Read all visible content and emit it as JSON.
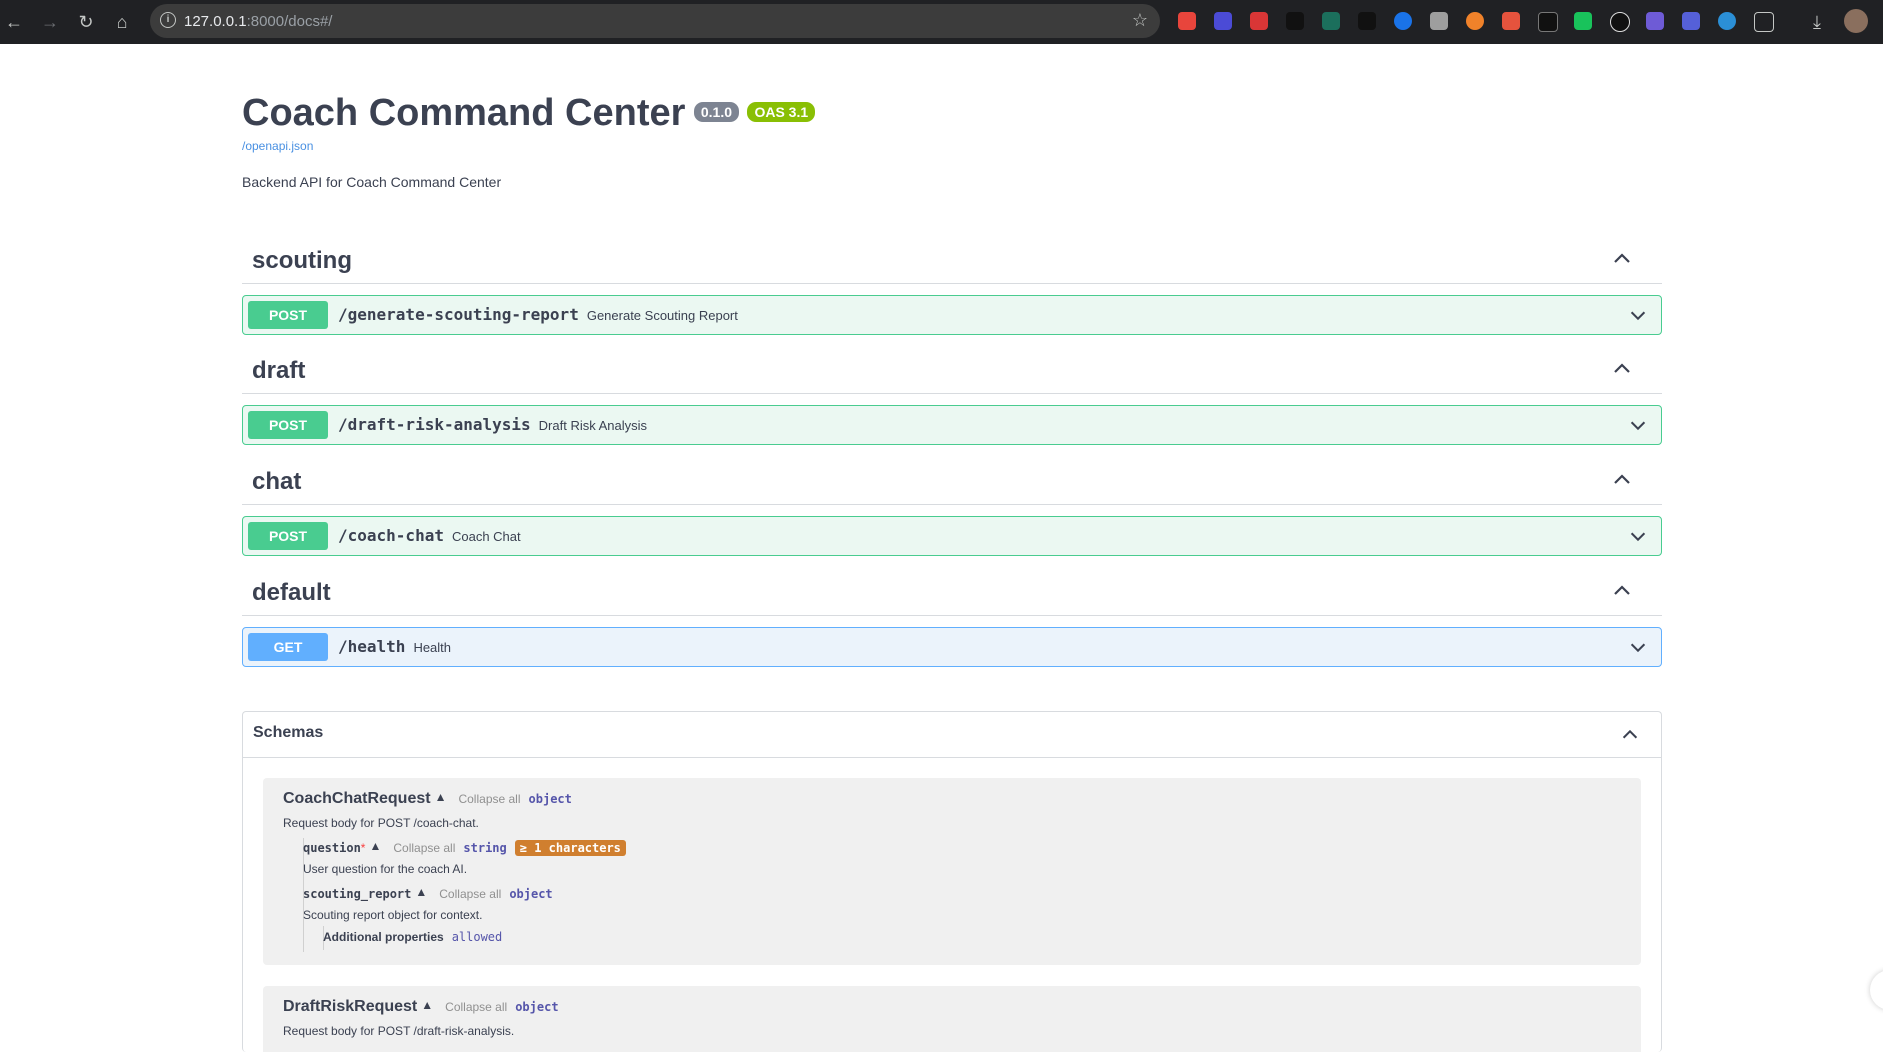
{
  "browser": {
    "url_host": "127.0.0.1",
    "url_rest": ":8000/docs#/"
  },
  "api": {
    "title": "Coach Command Center",
    "version": "0.1.0",
    "oas": "OAS 3.1",
    "spec_link": "/openapi.json",
    "description": "Backend API for Coach Command Center"
  },
  "tags": [
    {
      "name": "scouting",
      "op": {
        "method": "POST",
        "path": "/generate-scouting-report",
        "summary": "Generate Scouting Report"
      }
    },
    {
      "name": "draft",
      "op": {
        "method": "POST",
        "path": "/draft-risk-analysis",
        "summary": "Draft Risk Analysis"
      }
    },
    {
      "name": "chat",
      "op": {
        "method": "POST",
        "path": "/coach-chat",
        "summary": "Coach Chat"
      }
    },
    {
      "name": "default",
      "op": {
        "method": "GET",
        "path": "/health",
        "summary": "Health"
      }
    }
  ],
  "schemas": {
    "title": "Schemas",
    "models": [
      {
        "name": "CoachChatRequest",
        "collapse": "Collapse all",
        "type": "object",
        "description": "Request body for POST /coach-chat.",
        "props": [
          {
            "name": "question",
            "required": "*",
            "collapse": "Collapse all",
            "type": "string",
            "chip": "≥ 1 characters",
            "description": "User question for the coach AI."
          },
          {
            "name": "scouting_report",
            "collapse": "Collapse all",
            "type": "object",
            "description": "Scouting report object for context.",
            "additional_label": "Additional properties",
            "additional_value": "allowed"
          }
        ]
      },
      {
        "name": "DraftRiskRequest",
        "collapse": "Collapse all",
        "type": "object",
        "description": "Request body for POST /draft-risk-analysis."
      }
    ]
  }
}
